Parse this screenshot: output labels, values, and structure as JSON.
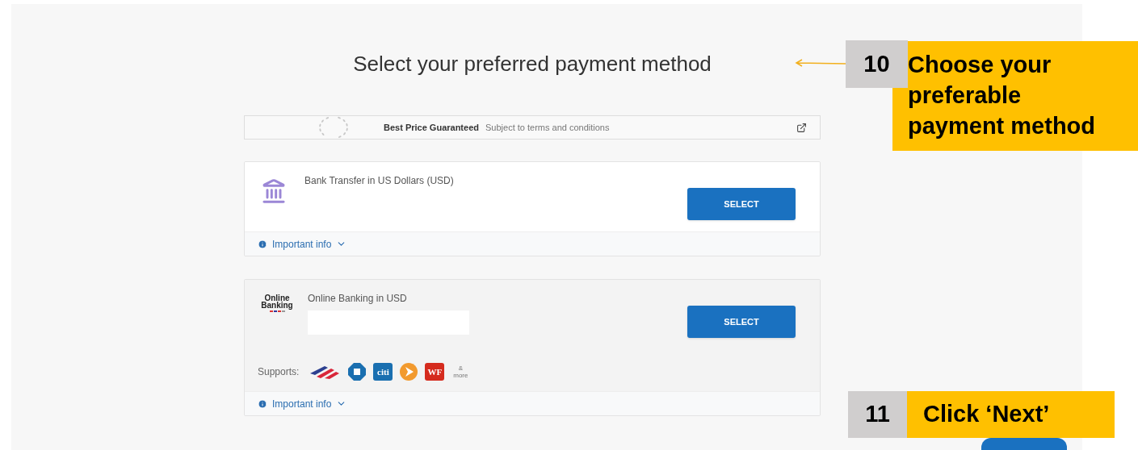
{
  "title": "Select your preferred payment method",
  "guarantee": {
    "label": "Best Price Guaranteed",
    "note": "Subject to terms and conditions"
  },
  "methods": [
    {
      "kind": "bank",
      "name": "Bank Transfer in US Dollars (USD)",
      "button": "SELECT",
      "info": "Important info",
      "expanded": false
    },
    {
      "kind": "online",
      "logo": "Online Banking",
      "name": "Online Banking in USD",
      "button": "SELECT",
      "info": "Important info",
      "expanded": false,
      "supports_label": "Supports:",
      "supports": [
        {
          "kind": "stripes"
        },
        {
          "kind": "octagon"
        },
        {
          "kind": "tile",
          "text": "citi",
          "color": "#1a6fb0"
        },
        {
          "kind": "arrow-circle"
        },
        {
          "kind": "tile",
          "text": "WF",
          "color": "#d52b1e"
        },
        {
          "kind": "more",
          "text": "& more"
        }
      ]
    }
  ],
  "callouts": [
    {
      "number": "10",
      "text": "Choose your preferable payment method",
      "kind": "arrow"
    },
    {
      "number": "11",
      "text": "Click ‘Next’",
      "kind": "button"
    }
  ]
}
